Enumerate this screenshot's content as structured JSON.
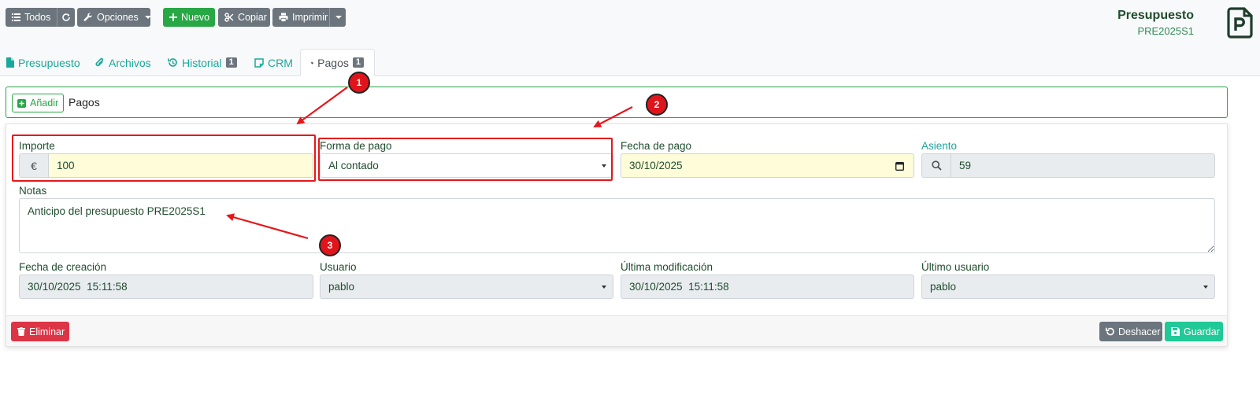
{
  "toolbar": {
    "todos_label": "Todos",
    "opciones_label": "Opciones",
    "nuevo_label": "Nuevo",
    "copiar_label": "Copiar",
    "imprimir_label": "Imprimir"
  },
  "document": {
    "title": "Presupuesto",
    "code": "PRE2025S1"
  },
  "tabs": [
    {
      "label": "Presupuesto",
      "icon": "file-icon"
    },
    {
      "label": "Archivos",
      "icon": "paperclip-icon"
    },
    {
      "label": "Historial",
      "icon": "history-icon",
      "badge": "1"
    },
    {
      "label": "CRM",
      "icon": "note-icon"
    },
    {
      "label": "Pagos",
      "icon": "coins-icon",
      "badge": "1",
      "active": true
    }
  ],
  "pagos": {
    "add_label": "Añadir",
    "section_label": "Pagos"
  },
  "form": {
    "importe": {
      "label": "Importe",
      "currency": "€",
      "value": "100"
    },
    "forma_pago": {
      "label": "Forma de pago",
      "value": "Al contado"
    },
    "fecha_pago": {
      "label": "Fecha de pago",
      "value": "30/10/2025"
    },
    "asiento": {
      "label": "Asiento",
      "value": "59"
    },
    "notas": {
      "label": "Notas",
      "value": "Anticipo del presupuesto PRE2025S1"
    },
    "fecha_creacion": {
      "label": "Fecha de creación",
      "value": "30/10/2025  15:11:58"
    },
    "usuario": {
      "label": "Usuario",
      "value": "pablo"
    },
    "ultima_modificacion": {
      "label": "Última modificación",
      "value": "30/10/2025  15:11:58"
    },
    "ultimo_usuario": {
      "label": "Último usuario",
      "value": "pablo"
    }
  },
  "footer": {
    "eliminar_label": "Eliminar",
    "deshacer_label": "Deshacer",
    "guardar_label": "Guardar"
  },
  "annotations": [
    {
      "number": "1"
    },
    {
      "number": "2"
    },
    {
      "number": "3"
    }
  ],
  "colors": {
    "primary_teal": "#1aa89a",
    "success_green": "#28a745",
    "danger_red": "#dc3545",
    "annotation_red": "#e6171b"
  }
}
